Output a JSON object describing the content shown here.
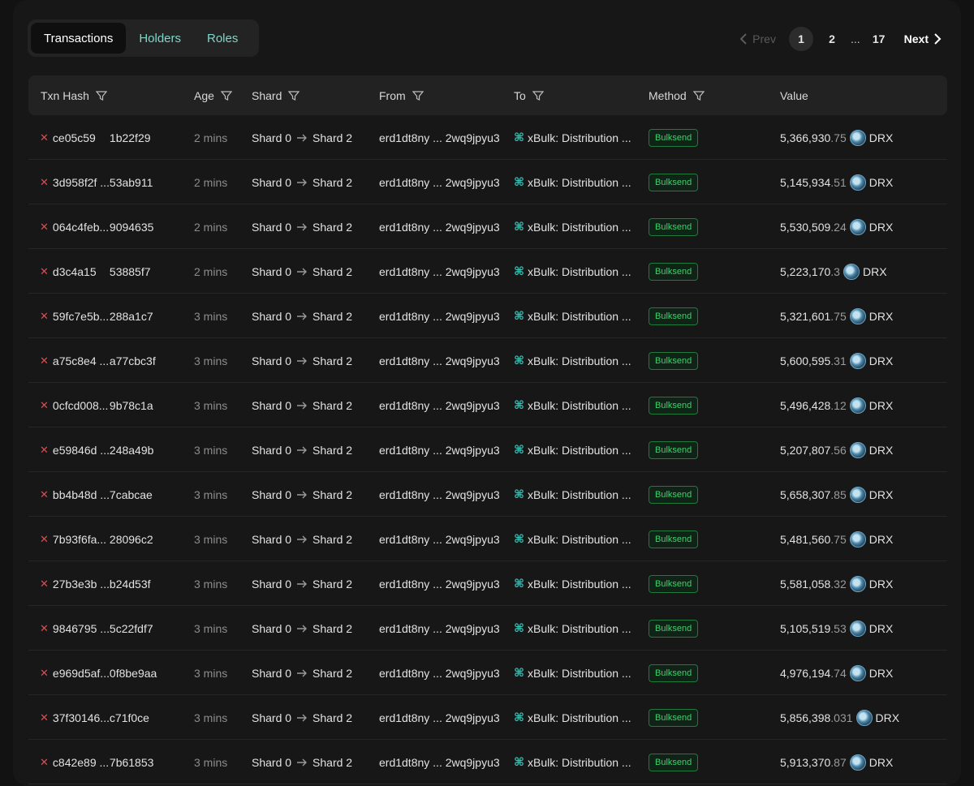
{
  "tabs": [
    {
      "label": "Transactions",
      "active": true
    },
    {
      "label": "Holders",
      "active": false
    },
    {
      "label": "Roles",
      "active": false
    }
  ],
  "pager": {
    "prev": "Prev",
    "pages": [
      "1",
      "2"
    ],
    "dots": "...",
    "last": "17",
    "next": "Next"
  },
  "columns": [
    "Txn Hash",
    "Age",
    "Shard",
    "From",
    "To",
    "Method",
    "Value"
  ],
  "rows": [
    {
      "hash_a": "ce05c59",
      "hash_b": "1b22f29",
      "age": "2 mins",
      "from_shard": "Shard 0",
      "to_shard": "Shard 2",
      "from": "erd1dt8ny ... 2wq9jpyu3",
      "to": "xBulk: Distribution ...",
      "method": "Bulksend",
      "value_int": "5,366,930",
      "value_dec": ".75",
      "token": "DRX"
    },
    {
      "hash_a": "3d958f2f ...",
      "hash_b": "53ab911",
      "age": "2 mins",
      "from_shard": "Shard 0",
      "to_shard": "Shard 2",
      "from": "erd1dt8ny ... 2wq9jpyu3",
      "to": "xBulk: Distribution ...",
      "method": "Bulksend",
      "value_int": "5,145,934",
      "value_dec": ".51",
      "token": "DRX"
    },
    {
      "hash_a": "064c4feb...",
      "hash_b": "9094635",
      "age": "2 mins",
      "from_shard": "Shard 0",
      "to_shard": "Shard 2",
      "from": "erd1dt8ny ... 2wq9jpyu3",
      "to": "xBulk: Distribution ...",
      "method": "Bulksend",
      "value_int": "5,530,509",
      "value_dec": ".24",
      "token": "DRX"
    },
    {
      "hash_a": "d3c4a15",
      "hash_b": "53885f7",
      "age": "2 mins",
      "from_shard": "Shard 0",
      "to_shard": "Shard 2",
      "from": "erd1dt8ny ... 2wq9jpyu3",
      "to": "xBulk: Distribution ...",
      "method": "Bulksend",
      "value_int": "5,223,170",
      "value_dec": ".3",
      "token": "DRX"
    },
    {
      "hash_a": "59fc7e5b...",
      "hash_b": "288a1c7",
      "age": "3 mins",
      "from_shard": "Shard 0",
      "to_shard": "Shard 2",
      "from": "erd1dt8ny ... 2wq9jpyu3",
      "to": "xBulk: Distribution ...",
      "method": "Bulksend",
      "value_int": "5,321,601",
      "value_dec": ".75",
      "token": "DRX"
    },
    {
      "hash_a": "a75c8e4 ...",
      "hash_b": "a77cbc3f",
      "age": "3 mins",
      "from_shard": "Shard 0",
      "to_shard": "Shard 2",
      "from": "erd1dt8ny ... 2wq9jpyu3",
      "to": "xBulk: Distribution ...",
      "method": "Bulksend",
      "value_int": "5,600,595",
      "value_dec": ".31",
      "token": "DRX"
    },
    {
      "hash_a": "0cfcd008...",
      "hash_b": "9b78c1a",
      "age": "3 mins",
      "from_shard": "Shard 0",
      "to_shard": "Shard 2",
      "from": "erd1dt8ny ... 2wq9jpyu3",
      "to": "xBulk: Distribution ...",
      "method": "Bulksend",
      "value_int": "5,496,428",
      "value_dec": ".12",
      "token": "DRX"
    },
    {
      "hash_a": "e59846d ...",
      "hash_b": "248a49b",
      "age": "3 mins",
      "from_shard": "Shard 0",
      "to_shard": "Shard 2",
      "from": "erd1dt8ny ... 2wq9jpyu3",
      "to": "xBulk: Distribution ...",
      "method": "Bulksend",
      "value_int": "5,207,807",
      "value_dec": ".56",
      "token": "DRX"
    },
    {
      "hash_a": "bb4b48d ...",
      "hash_b": "7cabcae",
      "age": "3 mins",
      "from_shard": "Shard 0",
      "to_shard": "Shard 2",
      "from": "erd1dt8ny ... 2wq9jpyu3",
      "to": "xBulk: Distribution ...",
      "method": "Bulksend",
      "value_int": "5,658,307",
      "value_dec": ".85",
      "token": "DRX"
    },
    {
      "hash_a": "7b93f6fa...",
      "hash_b": "28096c2",
      "age": "3 mins",
      "from_shard": "Shard 0",
      "to_shard": "Shard 2",
      "from": "erd1dt8ny ... 2wq9jpyu3",
      "to": "xBulk: Distribution ...",
      "method": "Bulksend",
      "value_int": "5,481,560",
      "value_dec": ".75",
      "token": "DRX"
    },
    {
      "hash_a": "27b3e3b ...",
      "hash_b": "b24d53f",
      "age": "3 mins",
      "from_shard": "Shard 0",
      "to_shard": "Shard 2",
      "from": "erd1dt8ny ... 2wq9jpyu3",
      "to": "xBulk: Distribution ...",
      "method": "Bulksend",
      "value_int": "5,581,058",
      "value_dec": ".32",
      "token": "DRX"
    },
    {
      "hash_a": "9846795 ...",
      "hash_b": "5c22fdf7",
      "age": "3 mins",
      "from_shard": "Shard 0",
      "to_shard": "Shard 2",
      "from": "erd1dt8ny ... 2wq9jpyu3",
      "to": "xBulk: Distribution ...",
      "method": "Bulksend",
      "value_int": "5,105,519",
      "value_dec": ".53",
      "token": "DRX"
    },
    {
      "hash_a": "e969d5af...",
      "hash_b": "0f8be9aa",
      "age": "3 mins",
      "from_shard": "Shard 0",
      "to_shard": "Shard 2",
      "from": "erd1dt8ny ... 2wq9jpyu3",
      "to": "xBulk: Distribution ...",
      "method": "Bulksend",
      "value_int": "4,976,194",
      "value_dec": ".74",
      "token": "DRX"
    },
    {
      "hash_a": "37f30146...",
      "hash_b": "c71f0ce",
      "age": "3 mins",
      "from_shard": "Shard 0",
      "to_shard": "Shard 2",
      "from": "erd1dt8ny ... 2wq9jpyu3",
      "to": "xBulk: Distribution ...",
      "method": "Bulksend",
      "value_int": "5,856,398",
      "value_dec": ".031",
      "token": "DRX"
    },
    {
      "hash_a": "c842e89 ...",
      "hash_b": "7b61853",
      "age": "3 mins",
      "from_shard": "Shard 0",
      "to_shard": "Shard 2",
      "from": "erd1dt8ny ... 2wq9jpyu3",
      "to": "xBulk: Distribution ...",
      "method": "Bulksend",
      "value_int": "5,913,370",
      "value_dec": ".87",
      "token": "DRX"
    }
  ],
  "colors": {
    "accent": "#7fd6c9",
    "fail": "#e5484d",
    "badge": "#3ed26a"
  }
}
